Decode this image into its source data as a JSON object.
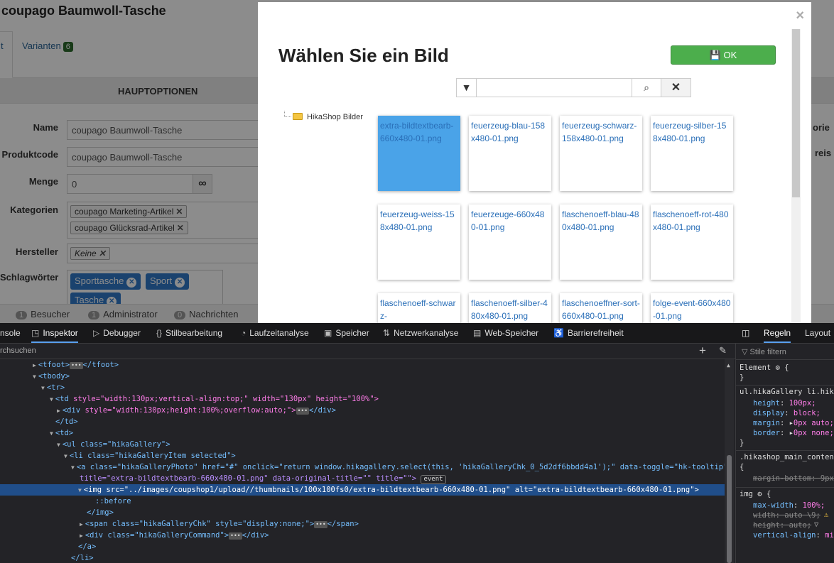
{
  "admin": {
    "product_title": "coupago Baumwoll-Tasche",
    "tab_active": "t",
    "tab_variants": "Varianten",
    "tab_variants_count": "6",
    "section": "HAUPTOPTIONEN",
    "fields": {
      "name_label": "Name",
      "name_value": "coupago Baumwoll-Tasche",
      "code_label": "Produktcode",
      "code_value": "coupago Baumwoll-Tasche",
      "qty_label": "Menge",
      "qty_value": "0",
      "cat_label": "Kategorien",
      "categories": [
        "coupago Marketing-Artikel",
        "coupago Glücksrad-Artikel"
      ],
      "maker_label": "Hersteller",
      "maker_value": "Keine",
      "tags_label": "Schlagwörter",
      "tags": [
        "Sporttasche",
        "Sport",
        "Tasche"
      ]
    },
    "right_labels": [
      "orie",
      "reis"
    ],
    "status": [
      {
        "count": "1",
        "label": "Besucher"
      },
      {
        "count": "1",
        "label": "Administrator"
      },
      {
        "count": "0",
        "label": "Nachrichten"
      }
    ]
  },
  "modal": {
    "title": "Wählen Sie ein Bild",
    "ok_label": "OK",
    "close": "×",
    "search_value": "",
    "tree_root": "HikaShop Bilder",
    "gallery": [
      "extra-bildtextbearb-660x480-01.png",
      "feuerzeug-blau-158x480-01.png",
      "feuerzeug-schwarz-158x480-01.png",
      "feuerzeug-silber-158x480-01.png",
      "feuerzeug-weiss-158x480-01.png",
      "feuerzeuge-660x480-01.png",
      "flaschenoeff-blau-480x480-01.png",
      "flaschenoeff-rot-480x480-01.png",
      "flaschenoeff-schwarz-",
      "flaschenoeff-silber-480x480-01.png",
      "flaschenoeffner-sort-660x480-01.png",
      "folge-event-660x480-01.png"
    ],
    "selected_index": 0
  },
  "devtools": {
    "tabs": [
      "nsole",
      "Inspektor",
      "Debugger",
      "Stilbearbeitung",
      "Laufzeitanalyse",
      "Speicher",
      "Netzwerkanalyse",
      "Web-Speicher",
      "Barrierefreiheit"
    ],
    "active_tab": "Inspektor",
    "search_placeholder": "rchsuchen",
    "side_tabs": [
      "Regeln",
      "Layout"
    ],
    "filter_placeholder": "Stile filtern",
    "tree": {
      "tfoot_open": "<tfoot>",
      "tfoot_close": "</tfoot>",
      "tbody": "<tbody>",
      "tr": "<tr>",
      "td1_tag": "<td",
      "td1_attrs": " style=\"width:130px;vertical-align:top;\" width=\"130px\" height=\"100%\">",
      "div1_tag": "<div",
      "div1_attrs": " style=\"width:130px;height:100%;overflow:auto;\">",
      "div1_close": "</div>",
      "td_close": "</td>",
      "td2": "<td>",
      "ul": "<ul class=\"hikaGallery\">",
      "li": "<li class=\"hikaGalleryItem selected\">",
      "a_line1": "<a class=\"hikaGalleryPhoto\" href=\"#\" onclick=\"return window.hikagallery.select(this, 'hikaGalleryChk_0_5d2df6bbdd4a1');\" data-toggle=\"hk-tooltip\" data-",
      "a_line2": "title=\"extra-bildtextbearb-660x480-01.png\" data-original-title=\"\" title=\"\">",
      "event_badge": "event",
      "img_line": "<img src=\"../images/coupshop1/upload//thumbnails/100x100fs0/extra-bildtextbearb-660x480-01.png\" alt=\"extra-bildtextbearb-660x480-01.png\">",
      "before": "::before",
      "img_close": "</img>",
      "span_line": "<span class=\"hikaGalleryChk\" style=\"display:none;\">",
      "span_close": "</span>",
      "div2_line": "<div class=\"hikaGalleryCommand\">",
      "div2_close": "</div>",
      "a_close": "</a>",
      "li_close": "</li>"
    },
    "rules": {
      "element": "Element",
      "brace_open": "{",
      "brace_close": "}",
      "sel1": "ul.hikaGallery li.hikaG",
      "r1": [
        {
          "p": "height",
          "v": "100px;"
        },
        {
          "p": "display",
          "v": "block;"
        },
        {
          "p": "margin",
          "v": "0px auto;"
        },
        {
          "p": "border",
          "v": "0px none;"
        }
      ],
      "sel2": ".hikashop_main_content",
      "r2_strike": "margin-bottom: 9px;",
      "sel3": "img",
      "r3": [
        {
          "p": "max-width",
          "v": "100%;"
        }
      ],
      "r3_strike1": "width: auto \\9;",
      "r3_strike2": "height: auto;",
      "r3_last_p": "vertical-align",
      "r3_last_v": "mid"
    }
  }
}
